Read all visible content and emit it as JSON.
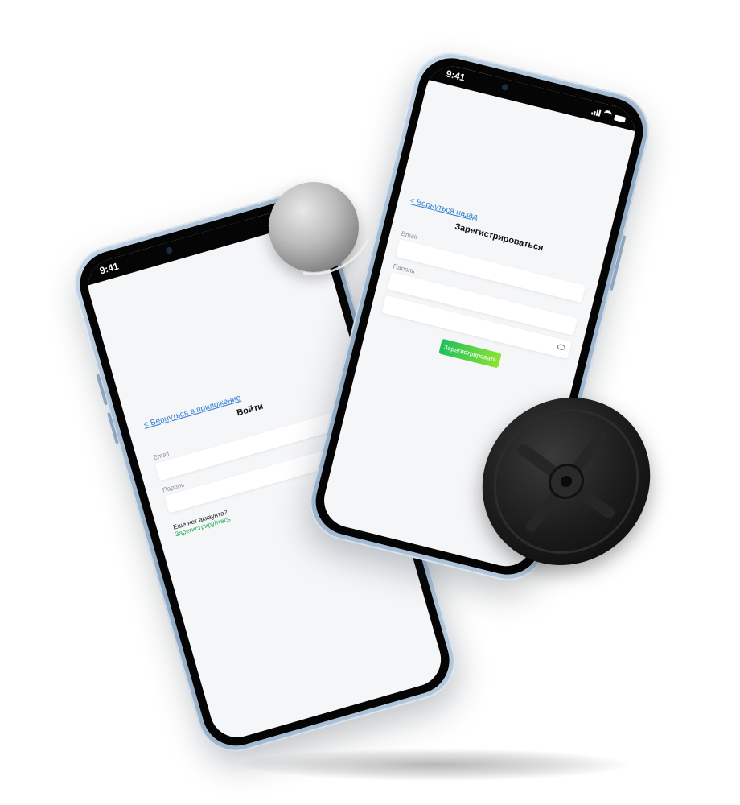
{
  "left_phone": {
    "time": "9:41",
    "back_link": "< Вернуться в приложение",
    "title": "Войти",
    "email_label": "Email",
    "password_label": "Пароль",
    "no_account": "Ещё нет аккаунта?",
    "register_link": "Зарегистрируйтесь"
  },
  "right_phone": {
    "time": "9:41",
    "back_link": "< Вернуться назад",
    "title": "Зарегистрироваться",
    "email_label": "Email",
    "password_label": "Пароль",
    "register_button": "Зарегистрировать"
  },
  "colors": {
    "link": "#2d7dd2",
    "button_gradient_start": "#1fbf5c",
    "button_gradient_end": "#8ee332",
    "phone_frame": "#9fb7cd"
  },
  "icons": {
    "eye": "eye-icon",
    "signal": "signal-icon",
    "wifi": "wifi-icon",
    "battery": "battery-icon"
  }
}
